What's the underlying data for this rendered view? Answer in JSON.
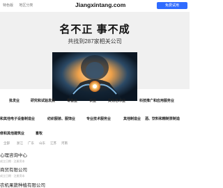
{
  "topbar": {
    "left_links": [
      "特色版",
      "地区分类"
    ],
    "site_title": "Jiangxintang.com",
    "cta_label": "免费试用"
  },
  "hero": {
    "headline": "名不正 事不成",
    "subline": "共找到287家相关公司"
  },
  "categories": [
    [
      "批发业",
      "研究和试验发展",
      "零售业",
      "农业",
      "文化艺术业",
      "科技推广和应用服务业"
    ],
    [
      "和其他电子设备制造业",
      "纺织服装、服饰业",
      "专业技术服务业",
      "其他制造业",
      "酒、饮料和精制茶制造"
    ],
    [
      "修和其他建筑业",
      "畜牧"
    ]
  ],
  "filters": [
    "全部",
    "浙江",
    "广东",
    "山东",
    "江苏",
    "河南"
  ],
  "list": [
    {
      "title": "心理咨询中心",
      "meta": "成立日期 · 注册资本"
    },
    {
      "title": "商贸有限公司",
      "meta": "成立日期 · 注册资本"
    },
    {
      "title": "农机果蔬种植有限公司",
      "meta": ""
    }
  ],
  "colors": {
    "accent": "#2f6bff",
    "hero_bg": "#f0f0f0"
  }
}
